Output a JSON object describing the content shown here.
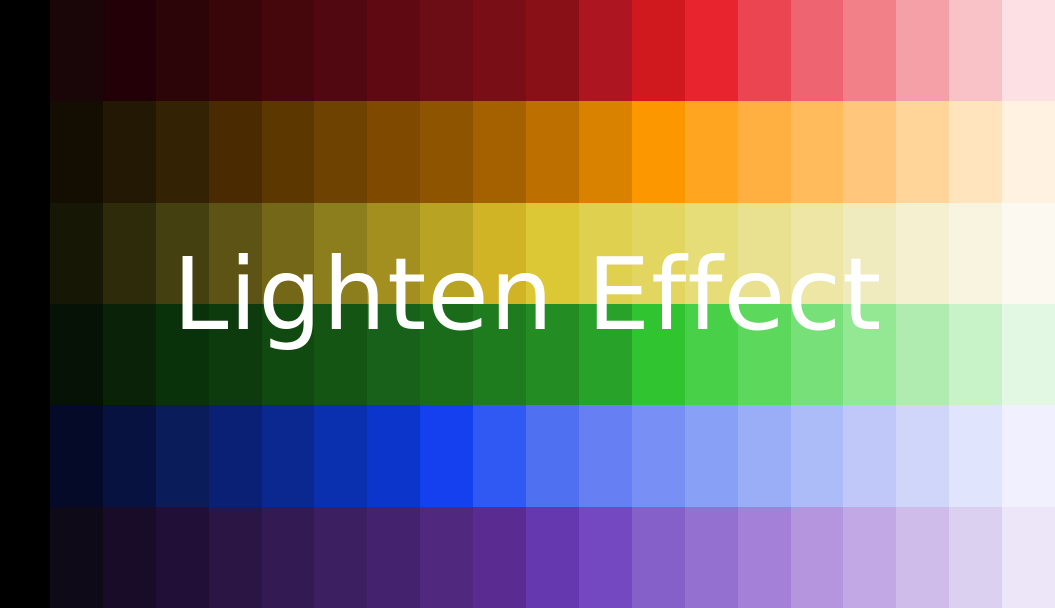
{
  "title": "Lighten Effect",
  "base_color": "#000000",
  "text_color": "#ffffff",
  "rows": [
    {
      "name": "red",
      "colors": [
        "#1a0508",
        "#230007",
        "#2c0508",
        "#380608",
        "#46070c",
        "#520810",
        "#5f0a12",
        "#6c0c14",
        "#7a0e16",
        "#8a1018",
        "#ad1520",
        "#d0191f",
        "#e8242e",
        "#ea4550",
        "#ee6470",
        "#f28088",
        "#f5a0a6",
        "#f9c2c6",
        "#fde0e3"
      ]
    },
    {
      "name": "orange",
      "colors": [
        "#140d02",
        "#231803",
        "#332204",
        "#4a2a00",
        "#5d3700",
        "#6e4200",
        "#7f4a00",
        "#8f5400",
        "#a56000",
        "#bd6f00",
        "#d98200",
        "#fd9700",
        "#ffa520",
        "#ffb040",
        "#ffbb5c",
        "#ffc67c",
        "#ffd59a",
        "#ffe4bd",
        "#fff2e0"
      ]
    },
    {
      "name": "yellow",
      "colors": [
        "#171706",
        "#2d2b0a",
        "#44400f",
        "#5c5314",
        "#746818",
        "#8c7e1c",
        "#a38f20",
        "#b9a322",
        "#d1b426",
        "#dcc835",
        "#e0d050",
        "#e3d660",
        "#e6dc78",
        "#e9e190",
        "#ede6a5",
        "#f0ebbe",
        "#f5f0d0",
        "#f8f4e0",
        "#fcfaf0"
      ]
    },
    {
      "name": "green",
      "colors": [
        "#061206",
        "#0a2208",
        "#0a320a",
        "#0d3b0d",
        "#104a10",
        "#145514",
        "#18611a",
        "#1a6c1a",
        "#1e7b1e",
        "#238c23",
        "#28a228",
        "#30c430",
        "#48d048",
        "#5cd85c",
        "#78e078",
        "#94e894",
        "#b0ecb0",
        "#c8f2c8",
        "#e2f8e2"
      ]
    },
    {
      "name": "blue",
      "colors": [
        "#050a28",
        "#071240",
        "#0a1c5a",
        "#0a2075",
        "#0a2890",
        "#0a30b0",
        "#0c35cc",
        "#1440f0",
        "#3058f2",
        "#5070f2",
        "#6680f4",
        "#788ff5",
        "#88a0f6",
        "#9aaef7",
        "#acbcf8",
        "#bfc8f9",
        "#d0d6fa",
        "#e0e4fc",
        "#f0f0fe"
      ]
    },
    {
      "name": "purple",
      "colors": [
        "#0e0a18",
        "#180c28",
        "#220f38",
        "#2a1545",
        "#341a52",
        "#3c1f60",
        "#45226e",
        "#50287e",
        "#5a2c92",
        "#6538b0",
        "#7448c0",
        "#8460c8",
        "#9470d0",
        "#a480d8",
        "#b495de",
        "#c2a8e4",
        "#d0bcea",
        "#dcd0f0",
        "#ece6f8"
      ]
    }
  ]
}
